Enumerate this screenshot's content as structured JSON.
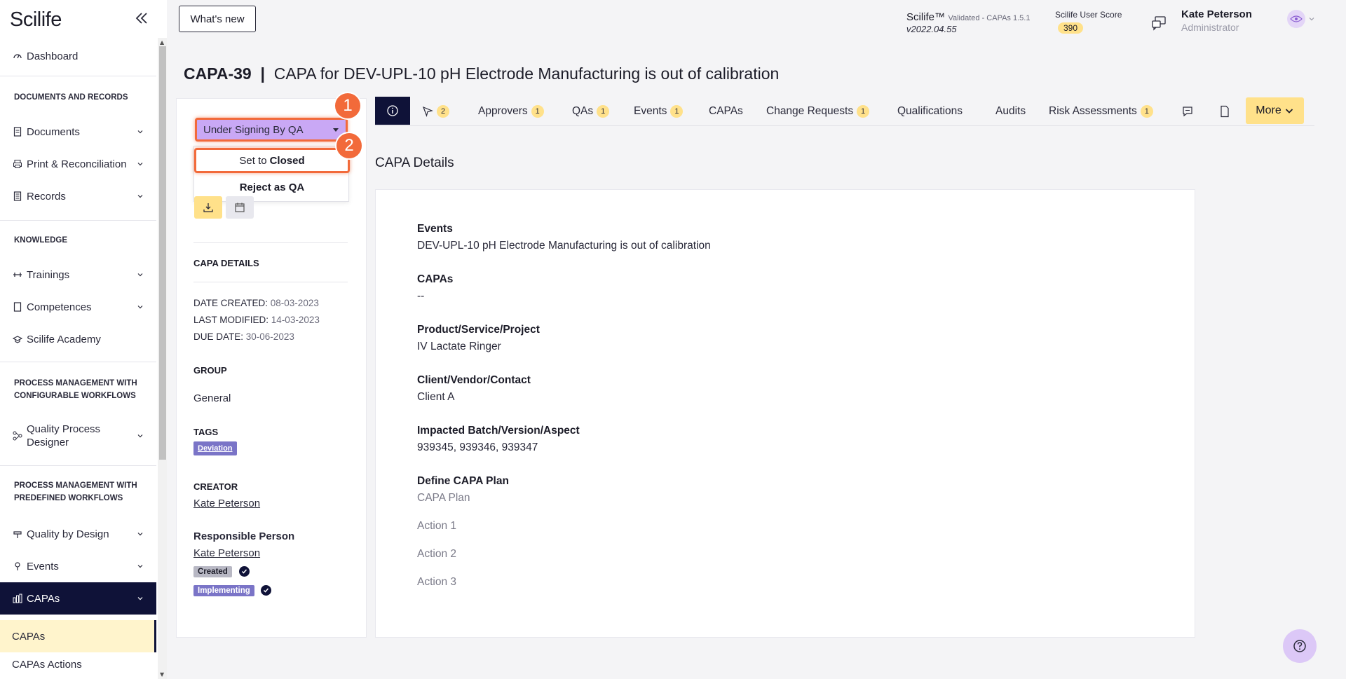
{
  "app": {
    "logo": "Scilife"
  },
  "header": {
    "whats_new": "What's new",
    "product_name": "Scilife™",
    "product_validated": "Validated - CAPAs 1.5.1",
    "version": "v2022.04.55",
    "score_label": "Scilife User Score",
    "score_value": "390",
    "user_name": "Kate Peterson",
    "user_role": "Administrator"
  },
  "sidebar": {
    "dashboard": "Dashboard",
    "sec_docs": "DOCUMENTS AND RECORDS",
    "documents": "Documents",
    "print_recon": "Print & Reconciliation",
    "records": "Records",
    "sec_knowledge": "KNOWLEDGE",
    "trainings": "Trainings",
    "competences": "Competences",
    "academy": "Scilife Academy",
    "sec_pm_config_1": "PROCESS MANAGEMENT WITH",
    "sec_pm_config_2": "CONFIGURABLE WORKFLOWS",
    "qpd_1": "Quality Process",
    "qpd_2": "Designer",
    "sec_pm_pre_1": "PROCESS MANAGEMENT WITH",
    "sec_pm_pre_2": "PREDEFINED WORKFLOWS",
    "qbd": "Quality by Design",
    "events": "Events",
    "capas": "CAPAs",
    "capas_sub": "CAPAs",
    "capas_actions": "CAPAs Actions"
  },
  "page": {
    "id": "CAPA-39",
    "separator": "|",
    "title": "CAPA for DEV-UPL-10 pH Electrode Manufacturing is out of calibration"
  },
  "status": {
    "current": "Under Signing By QA",
    "menu": [
      {
        "prefix": "Set to ",
        "bold": "Closed"
      },
      {
        "prefix": "",
        "bold": "Reject as QA"
      }
    ],
    "marker1": "1",
    "marker2": "2"
  },
  "left_panel": {
    "section": "CAPA DETAILS",
    "date_created_label": "DATE CREATED:",
    "date_created": "08-03-2023",
    "last_modified_label": "LAST MODIFIED:",
    "last_modified": "14-03-2023",
    "due_date_label": "DUE DATE:",
    "due_date": "30-06-2023",
    "group_label": "GROUP",
    "group": "General",
    "tags_label": "TAGS",
    "tag": "Deviation",
    "creator_label": "CREATOR",
    "creator": "Kate Peterson",
    "responsible_label": "Responsible Person",
    "responsible": "Kate Peterson",
    "chip_created": "Created",
    "chip_implementing": "Implementing"
  },
  "tabs": {
    "cursor_count": "2",
    "approvers": "Approvers",
    "approvers_count": "1",
    "qas": "QAs",
    "qas_count": "1",
    "events": "Events",
    "events_count": "1",
    "capas": "CAPAs",
    "change_requests": "Change Requests",
    "change_requests_count": "1",
    "qualifications": "Qualifications",
    "audits": "Audits",
    "risk": "Risk Assessments",
    "risk_count": "1",
    "more": "More"
  },
  "details": {
    "heading": "CAPA Details",
    "events_label": "Events",
    "events_value": "DEV-UPL-10 pH Electrode Manufacturing is out of calibration",
    "capas_label": "CAPAs",
    "capas_value": "--",
    "product_label": "Product/Service/Project",
    "product_value": "IV Lactate Ringer",
    "client_label": "Client/Vendor/Contact",
    "client_value": "Client A",
    "batch_label": "Impacted Batch/Version/Aspect",
    "batch_value": "939345, 939346, 939347",
    "plan_label": "Define CAPA Plan",
    "plan_value": "CAPA Plan",
    "action1": "Action 1",
    "action2": "Action 2",
    "action3": "Action 3"
  }
}
